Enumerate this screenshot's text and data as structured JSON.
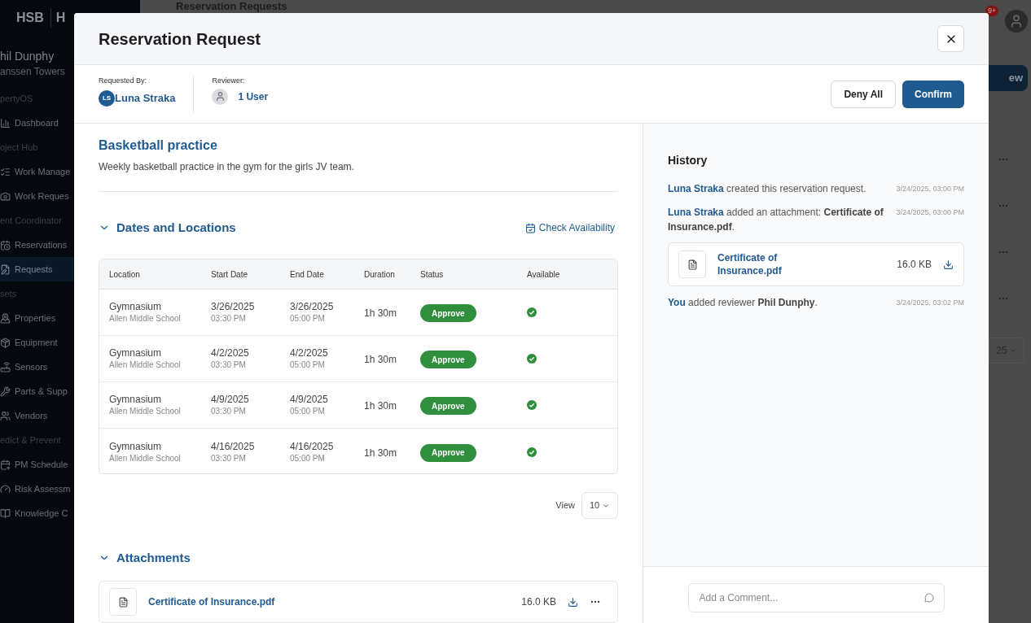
{
  "background": {
    "sidebar": {
      "brand": "HSB",
      "brand_second": "H",
      "user_name": "hil Dunphy",
      "property": "anssen Towers",
      "sections": [
        {
          "title": "pertyOS",
          "items": [
            {
              "label": "Dashboard",
              "selected": false
            }
          ]
        },
        {
          "title": "oject Hub",
          "items": [
            {
              "label": "Work Manage",
              "selected": false
            },
            {
              "label": "Work Reques",
              "selected": false
            }
          ]
        },
        {
          "title": "ent Coordinator",
          "items": [
            {
              "label": "Reservations",
              "selected": false
            },
            {
              "label": "Requests",
              "selected": true
            }
          ]
        },
        {
          "title": "sets",
          "items": [
            {
              "label": "Properties",
              "selected": false
            },
            {
              "label": "Equipment",
              "selected": false
            },
            {
              "label": "Sensors",
              "selected": false
            },
            {
              "label": "Parts & Supp",
              "selected": false
            },
            {
              "label": "Vendors",
              "selected": false
            }
          ]
        },
        {
          "title": "edict & Prevent",
          "items": [
            {
              "label": "PM Schedule",
              "selected": false
            },
            {
              "label": "Risk Assessm",
              "selected": false
            },
            {
              "label": "Knowledge C",
              "selected": false
            }
          ]
        }
      ]
    },
    "page_title": "Reservation Requests",
    "notification_badge": "9+",
    "new_button": "ew",
    "page_size": "25"
  },
  "modal": {
    "title": "Reservation Request",
    "requested_by": {
      "label": "Requested By:",
      "initials": "LS",
      "name": "Luna Straka"
    },
    "reviewer": {
      "label": "Reviewer:",
      "count": "1 User"
    },
    "deny_button": "Deny All",
    "confirm_button": "Confirm",
    "request": {
      "title": "Basketball practice",
      "description": "Weekly basketball practice in the gym for the girls JV team."
    },
    "dates": {
      "title": "Dates and Locations",
      "expanded": true,
      "check_availability": "Check Availability",
      "columns": [
        "Location",
        "Start Date",
        "End Date",
        "Duration",
        "Status",
        "Available"
      ],
      "rows": [
        {
          "location": "Gymnasium",
          "site": "Allen Middle School",
          "start_date": "3/26/2025",
          "start_time": "03:30 PM",
          "end_date": "3/26/2025",
          "end_time": "05:00 PM",
          "duration": "1h 30m",
          "status": "Approve",
          "available": true
        },
        {
          "location": "Gymnasium",
          "site": "Allen Middle School",
          "start_date": "4/2/2025",
          "start_time": "03:30 PM",
          "end_date": "4/2/2025",
          "end_time": "05:00 PM",
          "duration": "1h 30m",
          "status": "Approve",
          "available": true
        },
        {
          "location": "Gymnasium",
          "site": "Allen Middle School",
          "start_date": "4/9/2025",
          "start_time": "03:30 PM",
          "end_date": "4/9/2025",
          "end_time": "05:00 PM",
          "duration": "1h 30m",
          "status": "Approve",
          "available": true
        },
        {
          "location": "Gymnasium",
          "site": "Allen Middle School",
          "start_date": "4/16/2025",
          "start_time": "03:30 PM",
          "end_date": "4/16/2025",
          "end_time": "05:00 PM",
          "duration": "1h 30m",
          "status": "Approve",
          "available": true
        }
      ],
      "view_label": "View",
      "page_size": "10"
    },
    "attachments": {
      "title": "Attachments",
      "expanded": true,
      "items": [
        {
          "name": "Certificate of Insurance.pdf",
          "size": "16.0 KB"
        }
      ]
    },
    "history": {
      "title": "History",
      "entries": [
        {
          "text": "**Luna Straka** created this reservation request.",
          "time": "3/24/2025, 03:00 PM"
        },
        {
          "text": "**Luna Straka** added an attachment: **Certificate of Insurance.pdf**.",
          "time": "3/24/2025, 03:00 PM",
          "attachment": {
            "name": "Certificate of Insurance.pdf",
            "size": "16.0 KB"
          }
        },
        {
          "text": "**You** added reviewer **Phil Dunphy**.",
          "time": "3/24/2025, 03:02 PM"
        }
      ]
    },
    "comment_placeholder": "Add a Comment..."
  }
}
